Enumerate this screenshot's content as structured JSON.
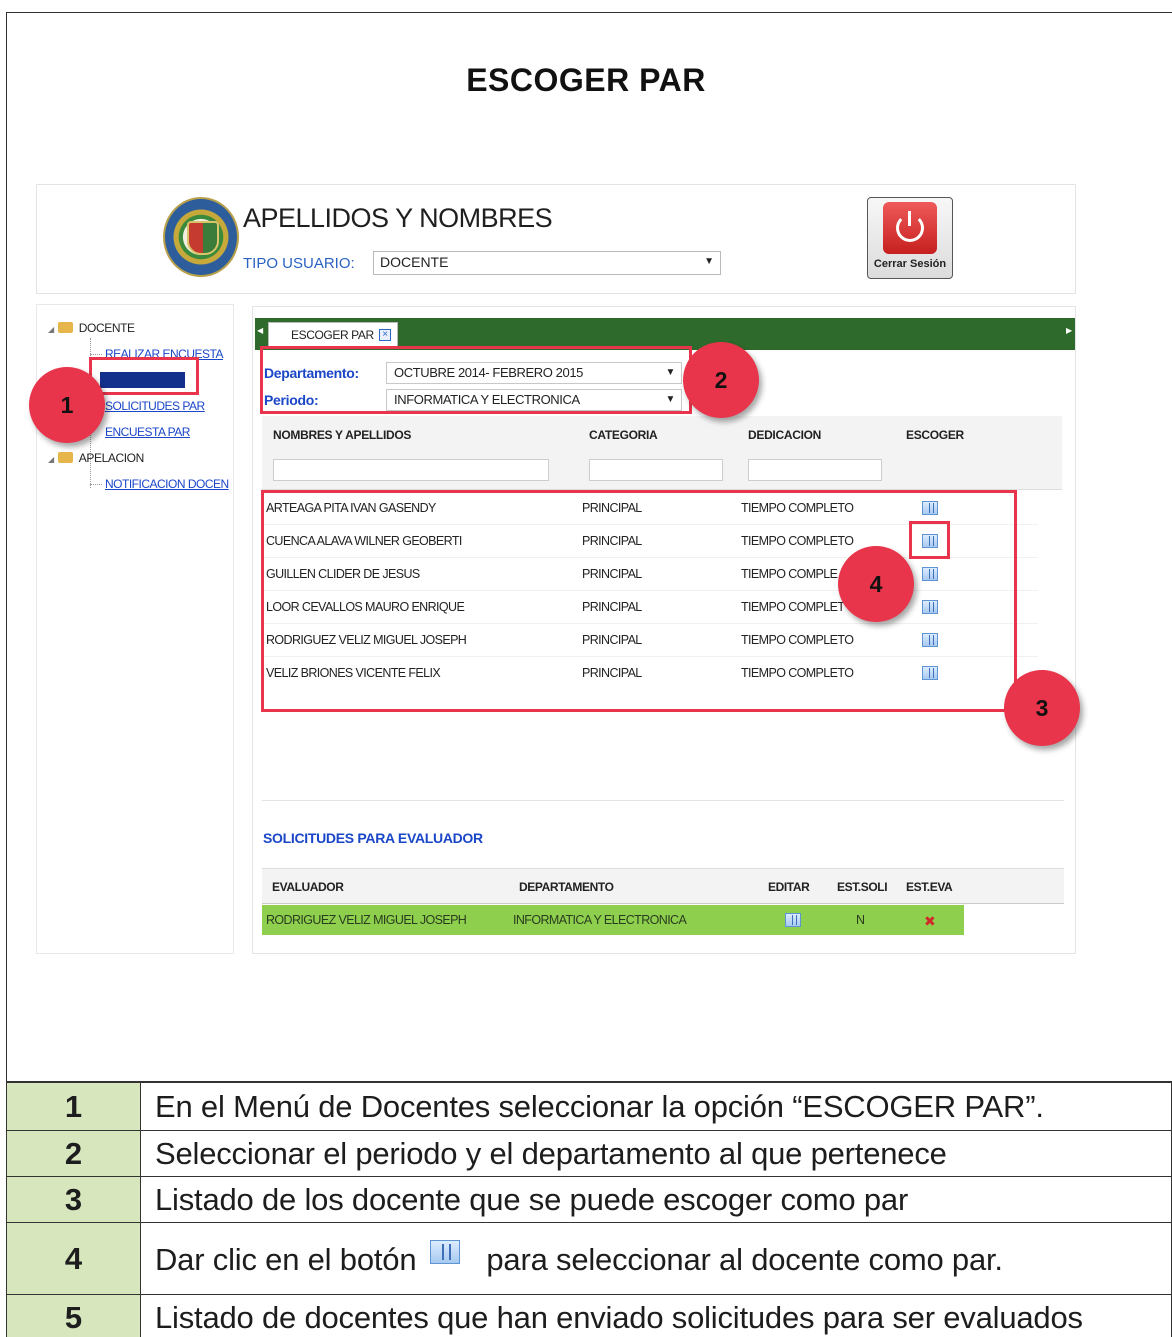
{
  "doc_title": "ESCOGER PAR",
  "header": {
    "user_name": "APELLIDOS Y NOMBRES",
    "user_type_label": "TIPO USUARIO:",
    "user_type_value": "DOCENTE",
    "logout_label": "Cerrar Sesión"
  },
  "sidebar": {
    "docente_label": "DOCENTE",
    "realizar_encuesta": "REALIZAR ENCUESTA",
    "solicitudes_par": "SOLICITUDES PAR",
    "encuesta_par": "ENCUESTA PAR",
    "apelacion_label": "APELACION",
    "notificacion": "NOTIFICACION DOCEN"
  },
  "tab": {
    "label": "ESCOGER PAR"
  },
  "filters": {
    "departamento_label": "Departamento:",
    "departamento_value": "OCTUBRE 2014- FEBRERO 2015",
    "periodo_label": "Periodo:",
    "periodo_value": "INFORMATICA Y ELECTRONICA"
  },
  "grid": {
    "columns": [
      "NOMBRES Y APELLIDOS",
      "CATEGORIA",
      "DEDICACION",
      "ESCOGER"
    ],
    "rows": [
      {
        "nombre": "ARTEAGA PITA IVAN GASENDY",
        "categoria": "PRINCIPAL",
        "dedicacion": "TIEMPO COMPLETO"
      },
      {
        "nombre": "CUENCA ALAVA WILNER GEOBERTI",
        "categoria": "PRINCIPAL",
        "dedicacion": "TIEMPO COMPLETO"
      },
      {
        "nombre": "GUILLEN CLIDER DE JESUS",
        "categoria": "PRINCIPAL",
        "dedicacion": "TIEMPO COMPLE"
      },
      {
        "nombre": "LOOR CEVALLOS MAURO ENRIQUE",
        "categoria": "PRINCIPAL",
        "dedicacion": "TIEMPO COMPLET"
      },
      {
        "nombre": "RODRIGUEZ VELIZ MIGUEL JOSEPH",
        "categoria": "PRINCIPAL",
        "dedicacion": "TIEMPO COMPLETO"
      },
      {
        "nombre": "VELIZ BRIONES VICENTE FELIX",
        "categoria": "PRINCIPAL",
        "dedicacion": "TIEMPO COMPLETO"
      }
    ]
  },
  "requests": {
    "title": "SOLICITUDES PARA EVALUADOR",
    "columns": [
      "EVALUADOR",
      "DEPARTAMENTO",
      "EDITAR",
      "EST.SOLI",
      "EST.EVA"
    ],
    "row": {
      "evaluador": "RODRIGUEZ VELIZ MIGUEL JOSEPH",
      "departamento": "INFORMATICA Y ELECTRONICA",
      "est_soli": "N"
    }
  },
  "annotations": [
    "1",
    "2",
    "3",
    "4"
  ],
  "legend": [
    {
      "num": "1",
      "text": "En el Menú de Docentes seleccionar la opción “ESCOGER PAR”."
    },
    {
      "num": "2",
      "text": "Seleccionar el periodo y el departamento al que pertenece"
    },
    {
      "num": "3",
      "text": "Listado de los docente que se puede escoger como par"
    },
    {
      "num": "4",
      "text_before": "Dar clic en el botón",
      "text_after": "para seleccionar al docente como par."
    },
    {
      "num": "5",
      "text": "Listado de docentes que han enviado solicitudes para ser evaluados"
    }
  ],
  "colors": {
    "annotation": "#e8354b",
    "tab_bar": "#2e6a2b",
    "link": "#1a46c8",
    "request_row": "#8ed04e",
    "legend_num_bg": "#d7e6bd"
  }
}
